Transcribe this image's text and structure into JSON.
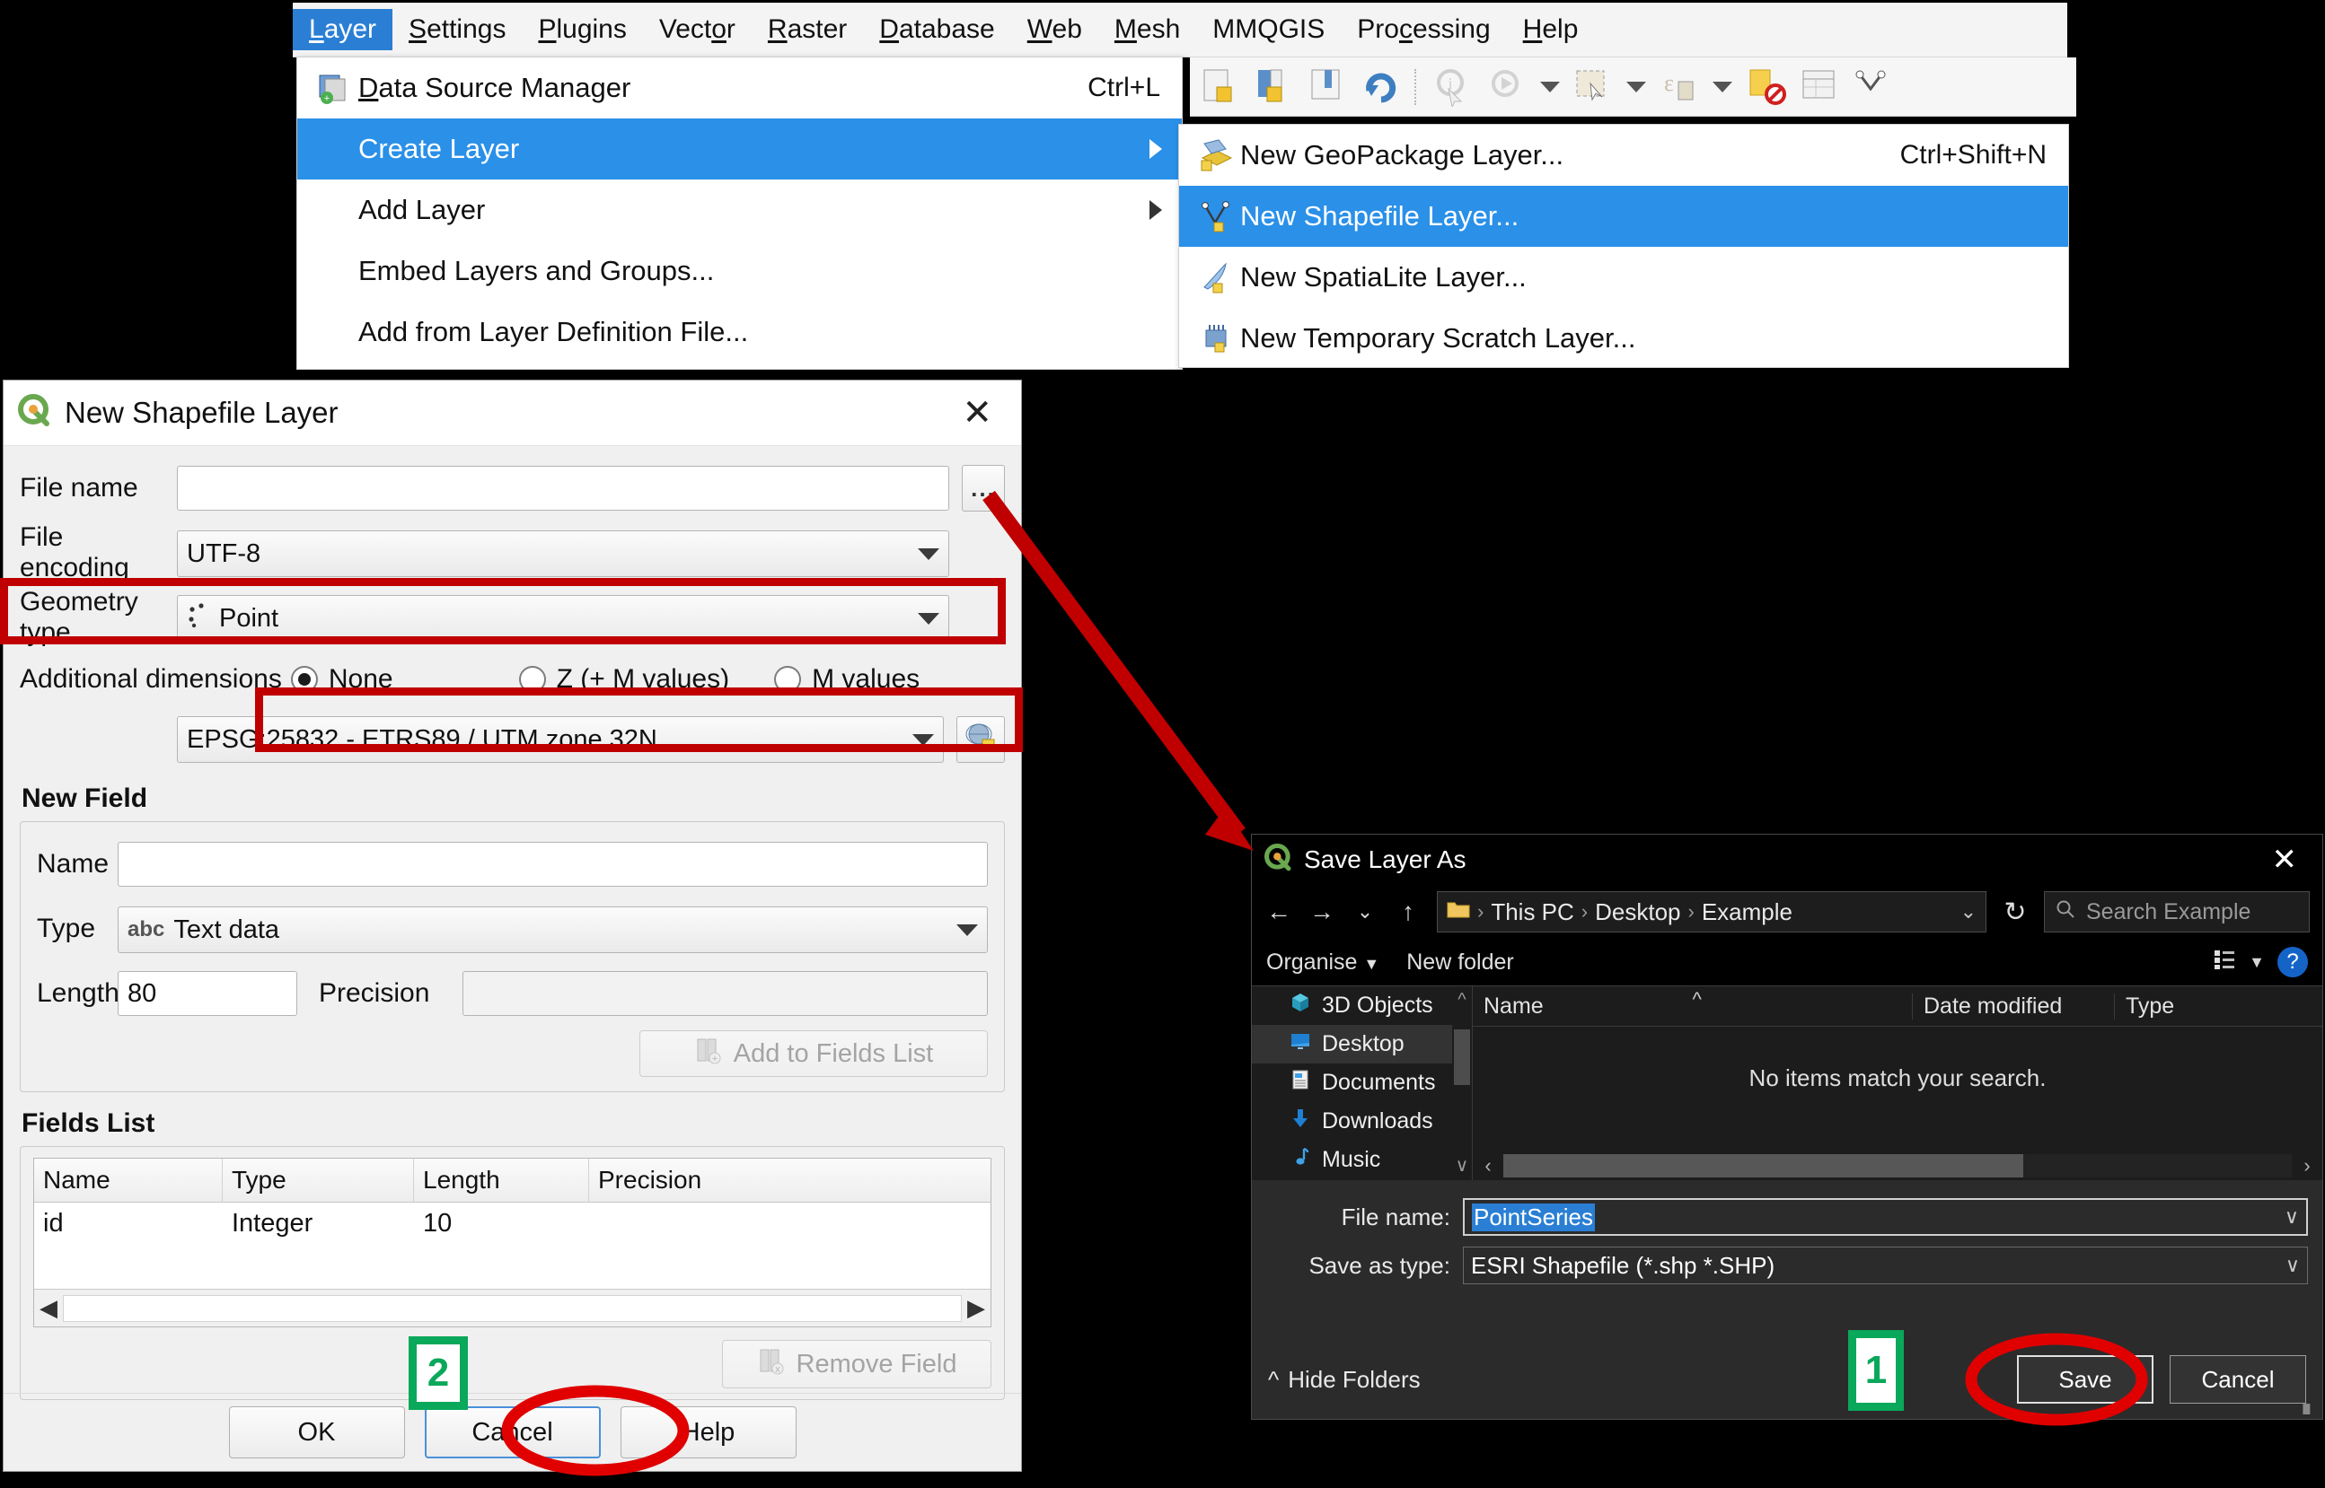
{
  "menubar": {
    "items": [
      {
        "label": "Layer",
        "accel": "L",
        "active": true
      },
      {
        "label": "Settings",
        "accel": "S",
        "active": false
      },
      {
        "label": "Plugins",
        "accel": "P",
        "active": false
      },
      {
        "label": "Vector",
        "accel": "o",
        "active": false
      },
      {
        "label": "Raster",
        "accel": "R",
        "active": false
      },
      {
        "label": "Database",
        "accel": "D",
        "active": false
      },
      {
        "label": "Web",
        "accel": "W",
        "active": false
      },
      {
        "label": "Mesh",
        "accel": "M",
        "active": false
      },
      {
        "label": "MMQGIS",
        "accel": "",
        "active": false
      },
      {
        "label": "Processing",
        "accel": "c",
        "active": false
      },
      {
        "label": "Help",
        "accel": "H",
        "active": false
      }
    ]
  },
  "layer_menu": {
    "items": [
      {
        "label": "Data Source Manager",
        "accel": "Ctrl+L",
        "icon": "data-source-manager-icon",
        "submenu": false,
        "selected": false
      },
      {
        "label": "Create Layer",
        "accel": "",
        "icon": "",
        "submenu": true,
        "selected": true
      },
      {
        "label": "Add Layer",
        "accel": "",
        "icon": "",
        "submenu": true,
        "selected": false
      },
      {
        "label": "Embed Layers and Groups...",
        "accel": "",
        "icon": "",
        "submenu": false,
        "selected": false
      },
      {
        "label": "Add from Layer Definition File...",
        "accel": "",
        "icon": "",
        "submenu": false,
        "selected": false
      }
    ]
  },
  "create_submenu": {
    "items": [
      {
        "label": "New GeoPackage Layer...",
        "accel": "Ctrl+Shift+N",
        "icon": "geopackage-icon",
        "selected": false
      },
      {
        "label": "New Shapefile Layer...",
        "accel": "",
        "icon": "shapefile-icon",
        "selected": true
      },
      {
        "label": "New SpatiaLite Layer...",
        "accel": "",
        "icon": "spatialite-icon",
        "selected": false
      },
      {
        "label": "New Temporary Scratch Layer...",
        "accel": "",
        "icon": "scratch-layer-icon",
        "selected": false
      }
    ]
  },
  "new_shapefile_dialog": {
    "title": "New Shapefile Layer",
    "close_label": "✕",
    "file_name": {
      "label": "File name",
      "value": "",
      "browse_label": "..."
    },
    "file_encoding": {
      "label": "File encoding",
      "value": "UTF-8"
    },
    "geometry_type": {
      "label": "Geometry type",
      "value": "Point"
    },
    "additional_dimensions": {
      "label": "Additional dimensions",
      "options": [
        {
          "label": "None",
          "selected": true
        },
        {
          "label": "Z (+ M values)",
          "selected": false
        },
        {
          "label": "M values",
          "selected": false
        }
      ]
    },
    "crs": {
      "value": "EPSG:25832 - ETRS89 / UTM zone 32N",
      "select_button": "select-crs-icon"
    },
    "new_field": {
      "section_title": "New Field",
      "name": {
        "label": "Name",
        "value": ""
      },
      "type": {
        "label": "Type",
        "value": "Text data",
        "prefix": "abc"
      },
      "length": {
        "label": "Length",
        "value": "80"
      },
      "precision": {
        "label": "Precision",
        "value": ""
      },
      "add_button": "Add to Fields List"
    },
    "fields_list": {
      "section_title": "Fields List",
      "columns": [
        "Name",
        "Type",
        "Length",
        "Precision"
      ],
      "rows": [
        [
          "id",
          "Integer",
          "10",
          ""
        ]
      ],
      "remove_button": "Remove Field"
    },
    "buttons": {
      "ok": "OK",
      "cancel": "Cancel",
      "help": "Help"
    }
  },
  "save_layer_as_dialog": {
    "title": "Save Layer As",
    "close_label": "✕",
    "nav": {
      "back": "←",
      "forward": "→",
      "recent": "⌄",
      "up": "↑",
      "refresh": "↻",
      "breadcrumbs": [
        "This PC",
        "Desktop",
        "Example"
      ],
      "dropdown": "⌄"
    },
    "search": {
      "placeholder": "Search Example",
      "icon": "search-icon"
    },
    "commands": {
      "organise": "Organise",
      "new_folder": "New folder",
      "view": "view-layout-icon",
      "help": "?"
    },
    "tree": {
      "items": [
        {
          "label": "3D Objects",
          "icon": "3d-objects-icon",
          "selected": false
        },
        {
          "label": "Desktop",
          "icon": "desktop-icon",
          "selected": true
        },
        {
          "label": "Documents",
          "icon": "documents-icon",
          "selected": false
        },
        {
          "label": "Downloads",
          "icon": "downloads-icon",
          "selected": false
        },
        {
          "label": "Music",
          "icon": "music-icon",
          "selected": false
        }
      ]
    },
    "file_pane": {
      "columns": [
        "Name",
        "Date modified",
        "Type"
      ],
      "empty_message": "No items match your search."
    },
    "file_name": {
      "label": "File name:",
      "value": "PointSeries"
    },
    "save_as_type": {
      "label": "Save as type:",
      "value": "ESRI Shapefile (*.shp *.SHP)"
    },
    "hide_folders": "Hide Folders",
    "buttons": {
      "save": "Save",
      "cancel": "Cancel"
    }
  },
  "annotations": {
    "step_1": "1",
    "step_2": "2",
    "highlight_color": "#c00000",
    "badge_color": "#0aa85a"
  }
}
